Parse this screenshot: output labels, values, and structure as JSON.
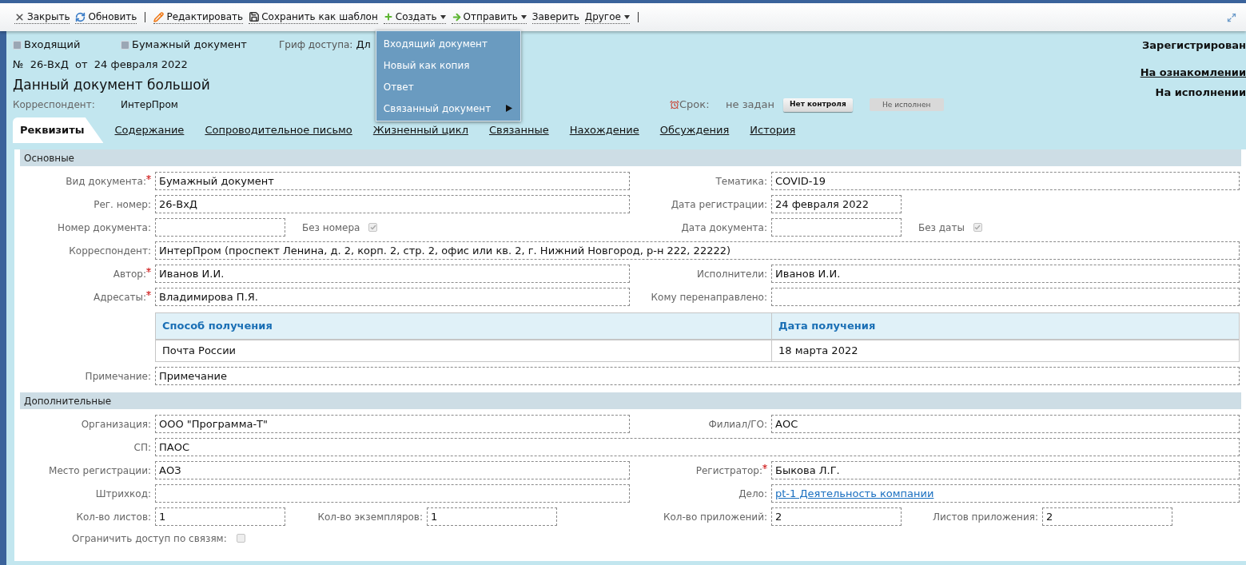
{
  "toolbar": {
    "items": [
      {
        "kind": "close",
        "label": "Закрыть"
      },
      {
        "kind": "refresh",
        "label": "Обновить"
      },
      {
        "kind": "separator"
      },
      {
        "kind": "edit",
        "label": "Редактировать"
      },
      {
        "kind": "save",
        "label": "Сохранить как шаблон"
      },
      {
        "kind": "create",
        "label": "Создать",
        "dropdown": true,
        "open": true,
        "menu": [
          {
            "label": "Входящий документ",
            "submenu": false
          },
          {
            "label": "Новый как копия",
            "submenu": false
          },
          {
            "label": "Ответ",
            "submenu": false
          },
          {
            "label": "Связанный документ",
            "submenu": true
          }
        ]
      },
      {
        "kind": "send",
        "label": "Отправить",
        "dropdown": true
      },
      {
        "kind": "plain",
        "label": "Заверить"
      },
      {
        "kind": "plain",
        "label": "Другое",
        "dropdown": true
      },
      {
        "kind": "separator"
      }
    ]
  },
  "header": {
    "tags": [
      "Входящий",
      "Бумажный документ"
    ],
    "access": {
      "label": "Гриф доступа:",
      "value": "Дл"
    },
    "number": "№  26-ВхД  от  24 февраля 2022",
    "title": "Данный документ большой",
    "correspondent": {
      "label": "Корреспондент:",
      "value": "ИнтерПром"
    },
    "deadline": {
      "label": "Срок:",
      "value": "не задан"
    },
    "control_button": "Нет контроля",
    "execution_badge": "Не исполнен",
    "statuses": [
      {
        "kind": "text",
        "label": "Зарегистрирован"
      },
      {
        "kind": "link",
        "label": "На ознакомлении"
      },
      {
        "kind": "text",
        "label": "На исполнении"
      }
    ]
  },
  "tabs": [
    {
      "label": "Реквизиты",
      "selected": true
    },
    {
      "label": "Содержание",
      "selected": false
    },
    {
      "label": "Сопроводительное письмо",
      "selected": false
    },
    {
      "label": "Жизненный цикл",
      "selected": false
    },
    {
      "label": "Связанные",
      "selected": false
    },
    {
      "label": "Нахождение",
      "selected": false
    },
    {
      "label": "Обсуждения",
      "selected": false
    },
    {
      "label": "История",
      "selected": false
    }
  ],
  "sections": [
    {
      "title": "Основные",
      "rows": [
        {
          "kind": "pair",
          "fields": [
            {
              "kind": "text",
              "label": "Вид документа:",
              "value": "Бумажный документ",
              "required": true
            },
            {
              "kind": "text",
              "label": "Тематика:",
              "value": "COVID-19"
            }
          ]
        },
        {
          "kind": "pair",
          "fields": [
            {
              "kind": "text",
              "label": "Рег. номер:",
              "value": "26-ВхД"
            },
            {
              "kind": "date",
              "label": "Дата регистрации:",
              "value": "24 февраля 2022"
            }
          ]
        },
        {
          "kind": "quad",
          "fields": [
            {
              "kind": "short",
              "label": "Номер документа:"
            },
            {
              "kind": "checkbox",
              "label": "Без номера",
              "checked": true
            },
            {
              "kind": "short",
              "label": "Дата документа:"
            },
            {
              "kind": "checkbox",
              "label": "Без даты",
              "checked": true
            }
          ]
        },
        {
          "kind": "full",
          "fields": [
            {
              "kind": "text",
              "label": "Корреспондент:",
              "value": "ИнтерПром (проспект Ленина, д. 2, корп. 2, стр. 2, офис или кв. 2, г. Нижний Новгород, р-н 222, 22222)"
            }
          ]
        },
        {
          "kind": "pair",
          "fields": [
            {
              "kind": "text",
              "label": "Автор:",
              "value": "Иванов И.И.",
              "required": true
            },
            {
              "kind": "text",
              "label": "Исполнители:",
              "value": "Иванов И.И."
            }
          ]
        },
        {
          "kind": "pair",
          "fields": [
            {
              "kind": "text",
              "label": "Адресаты:",
              "value": "Владимирова П.Я.",
              "required": true
            },
            {
              "kind": "text",
              "label": "Кому перенаправлено:"
            }
          ]
        },
        {
          "kind": "table",
          "columns": [
            "Способ получения",
            "Дата получения"
          ],
          "rows": [
            [
              "Почта России",
              "18 марта 2022"
            ]
          ]
        },
        {
          "kind": "full",
          "fields": [
            {
              "kind": "text",
              "label": "Примечание:",
              "value": "Примечание"
            }
          ]
        }
      ]
    },
    {
      "title": "Дополнительные",
      "rows": [
        {
          "kind": "pair",
          "fields": [
            {
              "kind": "text",
              "label": "Организация:",
              "value": "ООО \"Программа-Т\""
            },
            {
              "kind": "text",
              "label": "Филиал/ГО:",
              "value": "АОС"
            }
          ]
        },
        {
          "kind": "full",
          "fields": [
            {
              "kind": "text",
              "label": "СП:",
              "value": "ПАОС"
            }
          ]
        },
        {
          "kind": "pair",
          "fields": [
            {
              "kind": "text",
              "label": "Место регистрации:",
              "value": "АОЗ"
            },
            {
              "kind": "text",
              "label": "Регистратор:",
              "value": "Быкова Л.Г.",
              "required": true
            }
          ]
        },
        {
          "kind": "pair",
          "fields": [
            {
              "kind": "text",
              "label": "Штрихкод:"
            },
            {
              "kind": "link",
              "label": "Дело:",
              "value": "pt-1 Деятельность компании"
            }
          ]
        },
        {
          "kind": "quad",
          "fields": [
            {
              "kind": "short",
              "label": "Кол-во листов:",
              "value": "1"
            },
            {
              "kind": "short",
              "label": "Кол-во экземпляров:",
              "value": "1"
            },
            {
              "kind": "short",
              "label": "Кол-во приложений:",
              "value": "2"
            },
            {
              "kind": "short",
              "label": "Листов приложения:",
              "value": "2"
            }
          ]
        },
        {
          "kind": "checkbox_row",
          "fields": [
            {
              "kind": "checkbox",
              "label": "Ограничить доступ по связям:",
              "checked": false
            }
          ]
        }
      ]
    }
  ]
}
